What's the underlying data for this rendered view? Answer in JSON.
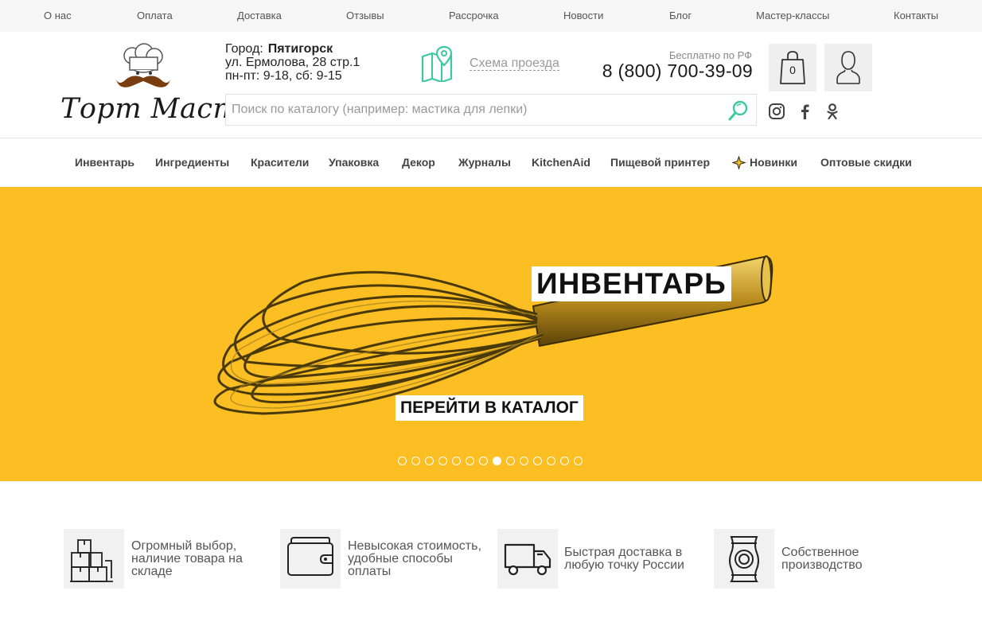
{
  "topnav": [
    "О нас",
    "Оплата",
    "Доставка",
    "Отзывы",
    "Рассрочка",
    "Новости",
    "Блог",
    "Мастер-классы",
    "Контакты"
  ],
  "logo": {
    "text": "Торт Мастер"
  },
  "location": {
    "city_label": "Город:",
    "city": "Пятигорск",
    "address": "ул. Ермолова, 28 стр.1",
    "hours": "пн-пт: 9-18, сб: 9-15"
  },
  "map_link": "Схема проезда",
  "contact": {
    "free_label": "Бесплатно по РФ",
    "phone": "8 (800) 700-39-09"
  },
  "cart": {
    "count": "0"
  },
  "search": {
    "placeholder": "Поиск по каталогу (например: мастика для лепки)"
  },
  "social_icons": [
    "instagram-icon",
    "facebook-icon",
    "odnoklassniki-icon"
  ],
  "catnav": [
    "Инвентарь",
    "Ингредиенты",
    "Красители",
    "Упаковка",
    "Декор",
    "Журналы",
    "KitchenAid",
    "Пищевой принтер",
    "Новинки",
    "Оптовые скидки"
  ],
  "banner": {
    "title": "ИНВЕНТАРЬ",
    "cta": "ПЕРЕЙТИ В КАТАЛОГ",
    "slides_total": 14,
    "active_slide": 8,
    "background": "#fbbf24"
  },
  "features": [
    {
      "icon": "boxes-icon",
      "lines": [
        "Огромный выбор,",
        "наличие товара на",
        "складе"
      ]
    },
    {
      "icon": "wallet-icon",
      "lines": [
        "Невысокая стоимость,",
        "удобные способы",
        "оплаты"
      ]
    },
    {
      "icon": "truck-icon",
      "lines": [
        "Быстрая доставка в",
        "любую точку России"
      ]
    },
    {
      "icon": "package-icon",
      "lines": [
        "Собственное",
        "производство"
      ]
    }
  ],
  "colors": {
    "accent": "#fbbf24",
    "map_icon": "#3cc9a0",
    "topbar_bg": "#f6f6f6"
  }
}
